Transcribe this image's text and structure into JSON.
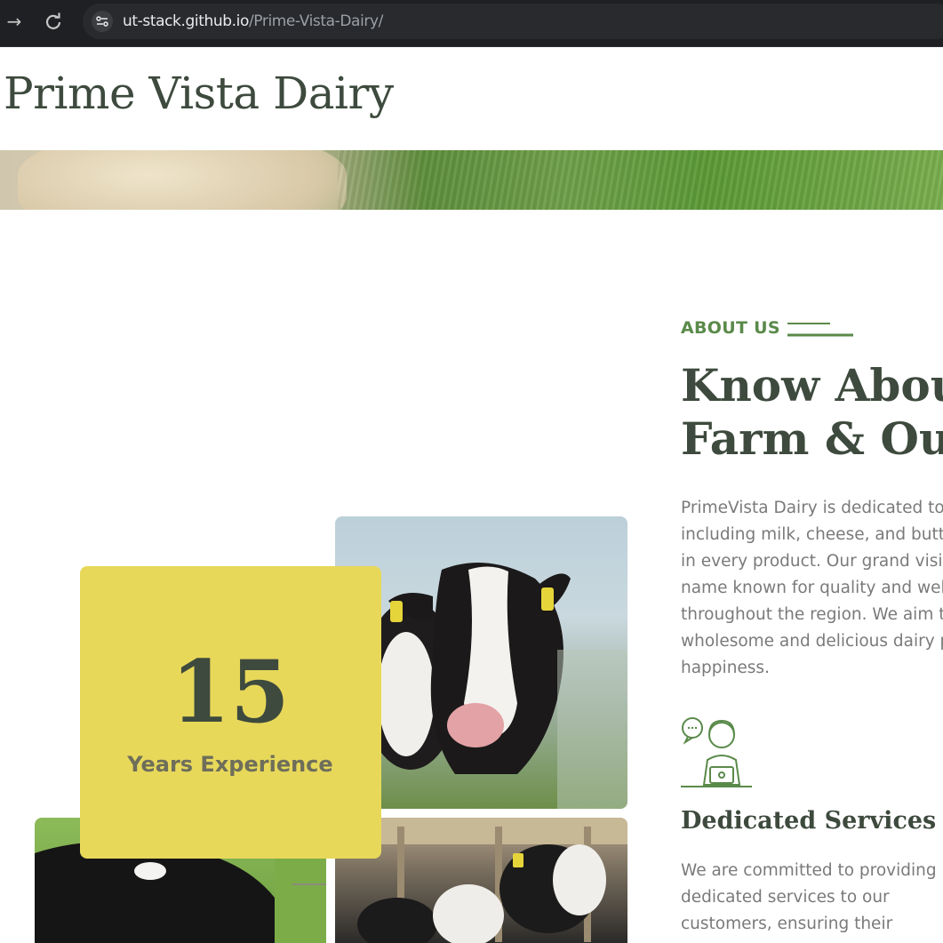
{
  "browser": {
    "url_host": "ut-stack.github.io",
    "url_path": "/Prime-Vista-Dairy/",
    "forward_icon": "arrow-right-icon",
    "reload_icon": "reload-icon",
    "site_info_icon": "tune-icon"
  },
  "site": {
    "title": "Prime Vista Dairy"
  },
  "about": {
    "label": "ABOUT US",
    "heading_lines": [
      "Know Abou",
      "Farm & Ou"
    ],
    "description_lines": [
      "PrimeVista Dairy is dedicated to",
      "including milk, cheese, and butt",
      "in every product. Our grand visio",
      "name known for quality and wel",
      "throughout the region. We aim t",
      "wholesome and delicious dairy p",
      "happiness."
    ]
  },
  "experience": {
    "number": "15",
    "label": "Years Experience"
  },
  "service": {
    "icon": "customer-support-icon",
    "title": "Dedicated Services",
    "description_lines": [
      "We are committed to providing",
      "dedicated services to our",
      "customers, ensuring their"
    ]
  },
  "colors": {
    "brand_dark_green": "#3d4a3d",
    "accent_green": "#5a8a4a",
    "experience_yellow": "#e8d85a"
  }
}
